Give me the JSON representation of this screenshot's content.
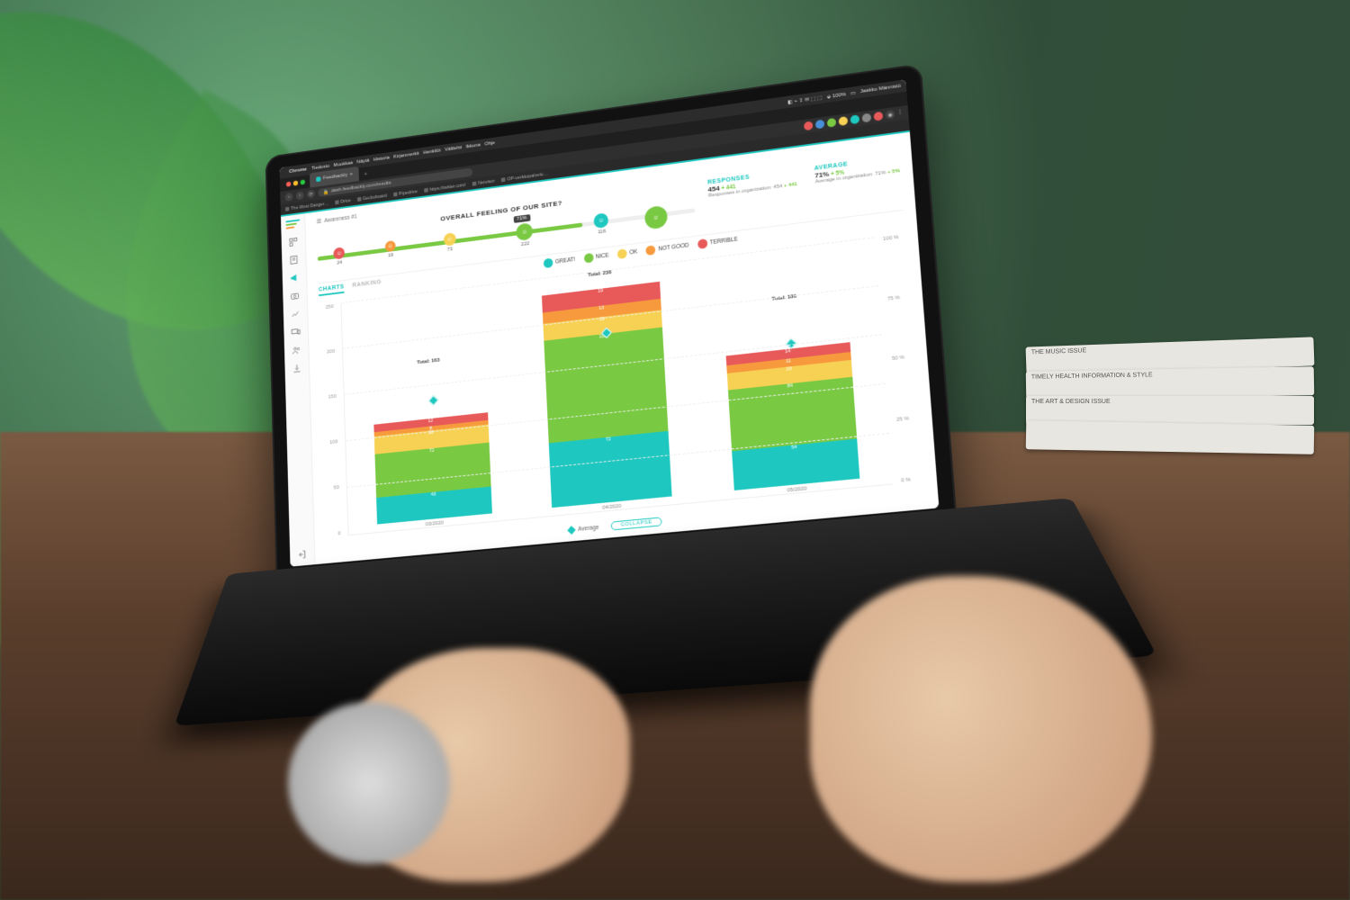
{
  "menubar": {
    "app": "Chrome",
    "items": [
      "Tiedosto",
      "Muokkaa",
      "Näytä",
      "Historia",
      "Kirjanmerkit",
      "Henkilöt",
      "Välilehti",
      "Ikkuna",
      "Ohje"
    ],
    "wifi": "100%",
    "clock": "",
    "user": "Jaakko Männistö"
  },
  "browser": {
    "tabs": [
      {
        "label": "Feedbackly",
        "active": true
      }
    ],
    "url": "dash.feedbackly.com/results",
    "bookmarks": [
      "The Most Danger…",
      "Drive",
      "Geckoboard",
      "Pipedrive",
      "https://twitter.com/",
      "Netvisor",
      "OP-verkkopalvelu…"
    ]
  },
  "colors": {
    "great": "#1ec8c0",
    "nice": "#7ac943",
    "ok": "#f7d154",
    "notgood": "#f79a3e",
    "terrible": "#e85a5a",
    "accent": "#1ec8c0"
  },
  "header": {
    "awareness_label": "Awareness #1",
    "question": "OVERALL FEELING OF OUR SITE?",
    "badge": "71%",
    "fill_pct": 71,
    "nodes": [
      {
        "pos": 6,
        "size": 14,
        "color": "#e85a5a",
        "val": "24"
      },
      {
        "pos": 20,
        "size": 13,
        "color": "#f79a3e",
        "val": "19"
      },
      {
        "pos": 36,
        "size": 15,
        "color": "#f7d154",
        "val": "73"
      },
      {
        "pos": 56,
        "size": 20,
        "color": "#7ac943",
        "val": "222"
      },
      {
        "pos": 76,
        "size": 17,
        "color": "#1ec8c0",
        "val": "116"
      },
      {
        "pos": 90,
        "size": 26,
        "color": "#7ac943",
        "val": ""
      }
    ],
    "responses": {
      "title": "RESPONSES",
      "value": "454",
      "delta": "+ 441",
      "sub_label": "Responses in organization:",
      "sub_value": "454",
      "sub_delta": "+ 441"
    },
    "average": {
      "title": "AVERAGE",
      "value": "71%",
      "delta": "+ 5%",
      "sub_label": "Average in organization:",
      "sub_value": "71%",
      "sub_delta": "+ 5%"
    }
  },
  "tabs": {
    "items": [
      "CHARTS",
      "RANKING"
    ],
    "active": 0
  },
  "legend": [
    {
      "label": "GREAT!",
      "color": "#1ec8c0"
    },
    {
      "label": "NICE",
      "color": "#7ac943"
    },
    {
      "label": "OK",
      "color": "#f7d154"
    },
    {
      "label": "NOT GOOD",
      "color": "#f79a3e"
    },
    {
      "label": "TERRIBLE",
      "color": "#e85a5a"
    }
  ],
  "chart_data": {
    "type": "bar",
    "stacked": true,
    "title": "",
    "xlabel": "",
    "ylabel": "",
    "ylim": [
      0,
      250
    ],
    "yticks": [
      0,
      50,
      100,
      150,
      200,
      250
    ],
    "right_axis": {
      "ylim": [
        0,
        100
      ],
      "ticks": [
        "0 %",
        "25 %",
        "50 %",
        "75 %",
        "100 %"
      ]
    },
    "categories": [
      "03/2020",
      "04/2020",
      "05/2020"
    ],
    "totals": [
      163,
      238,
      186
    ],
    "series": [
      {
        "name": "GREAT!",
        "color": "#1ec8c0",
        "values": [
          43,
          72,
          54
        ]
      },
      {
        "name": "NICE",
        "color": "#7ac943",
        "values": [
          72,
          115,
          84
        ]
      },
      {
        "name": "OK",
        "color": "#f7d154",
        "values": [
          28,
          19,
          23
        ]
      },
      {
        "name": "NOT GOOD",
        "color": "#f79a3e",
        "values": [
          8,
          13,
          11
        ]
      },
      {
        "name": "TERRIBLE",
        "color": "#e85a5a",
        "values": [
          12,
          19,
          14
        ]
      }
    ],
    "average_line": {
      "name": "Average",
      "values_pct": [
        71,
        71,
        72
      ]
    }
  },
  "footer": {
    "avg_label": "Average",
    "collapse": "COLLAPSE"
  }
}
